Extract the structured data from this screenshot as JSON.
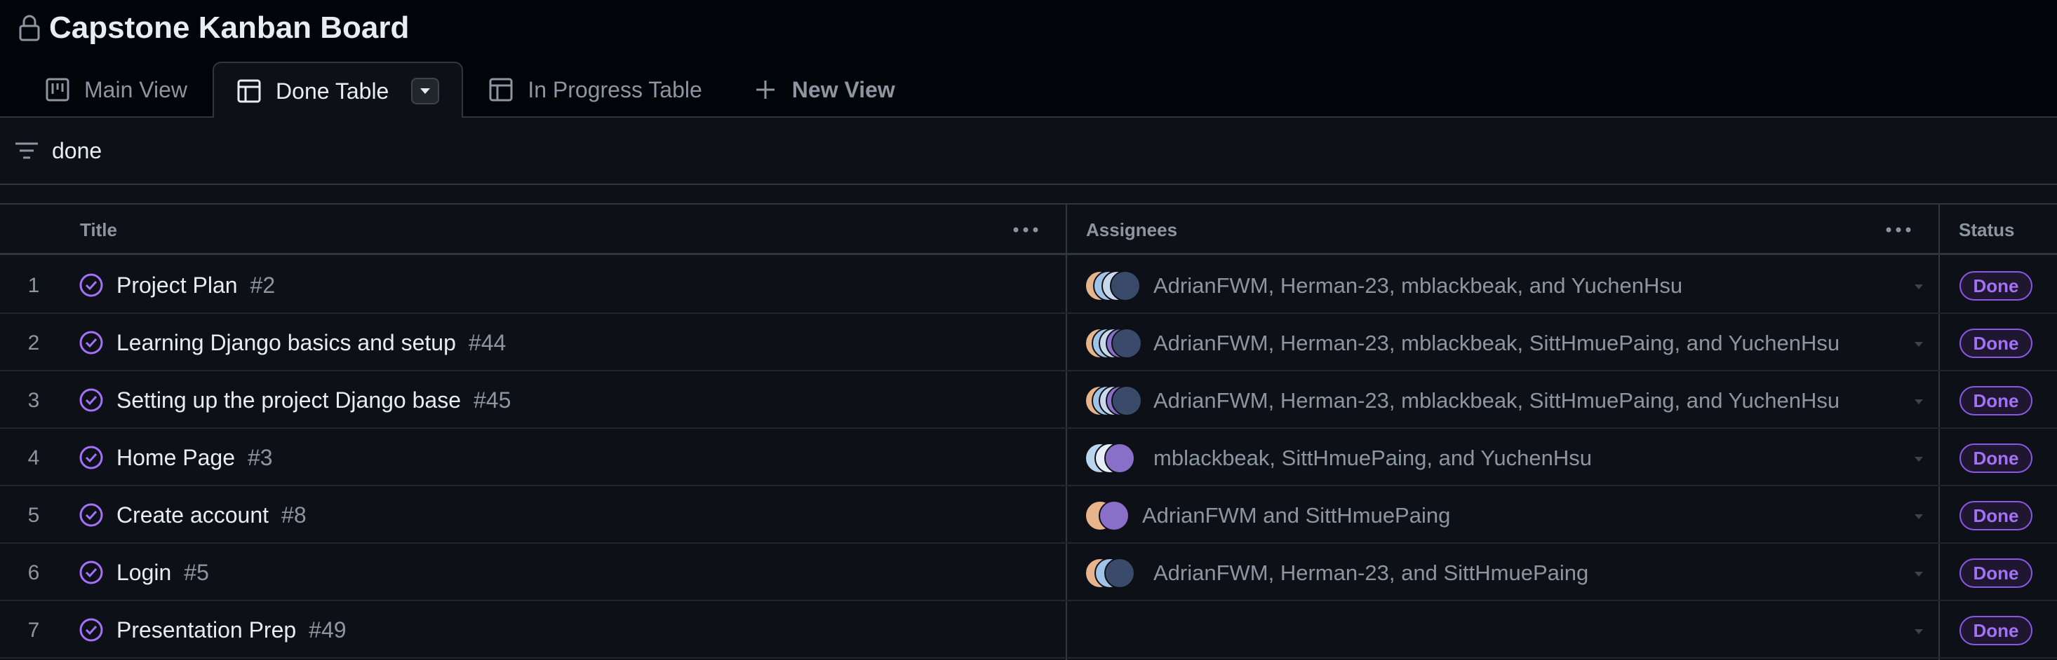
{
  "board": {
    "title": "Capstone Kanban Board"
  },
  "tabs": [
    {
      "label": "Main View"
    },
    {
      "label": "Done Table"
    },
    {
      "label": "In Progress Table"
    },
    {
      "label": "New View"
    }
  ],
  "filter": {
    "value": "done"
  },
  "columns": {
    "title": "Title",
    "assignees": "Assignees",
    "status": "Status"
  },
  "rows": [
    {
      "num": "1",
      "title": "Project Plan",
      "issue": "#2",
      "assignees": "AdrianFWM, Herman-23, mblackbeak, and YuchenHsu",
      "status": "Done"
    },
    {
      "num": "2",
      "title": "Learning Django basics and setup",
      "issue": "#44",
      "assignees": "AdrianFWM, Herman-23, mblackbeak, SittHmuePaing, and YuchenHsu",
      "status": "Done"
    },
    {
      "num": "3",
      "title": "Setting up the project Django base",
      "issue": "#45",
      "assignees": "AdrianFWM, Herman-23, mblackbeak, SittHmuePaing, and YuchenHsu",
      "status": "Done"
    },
    {
      "num": "4",
      "title": "Home Page",
      "issue": "#3",
      "assignees": "mblackbeak, SittHmuePaing, and YuchenHsu",
      "status": "Done"
    },
    {
      "num": "5",
      "title": "Create account",
      "issue": "#8",
      "assignees": "AdrianFWM and SittHmuePaing",
      "status": "Done"
    },
    {
      "num": "6",
      "title": "Login",
      "issue": "#5",
      "assignees": "AdrianFWM, Herman-23, and SittHmuePaing",
      "status": "Done"
    },
    {
      "num": "7",
      "title": "Presentation Prep",
      "issue": "#49",
      "assignees": "",
      "status": "Done"
    }
  ],
  "colors": {
    "background": "#010409",
    "surface": "#0d1117",
    "border": "#30363d",
    "text": "#e6edf3",
    "muted": "#8d96a0",
    "done_purple": "#a371f7"
  }
}
